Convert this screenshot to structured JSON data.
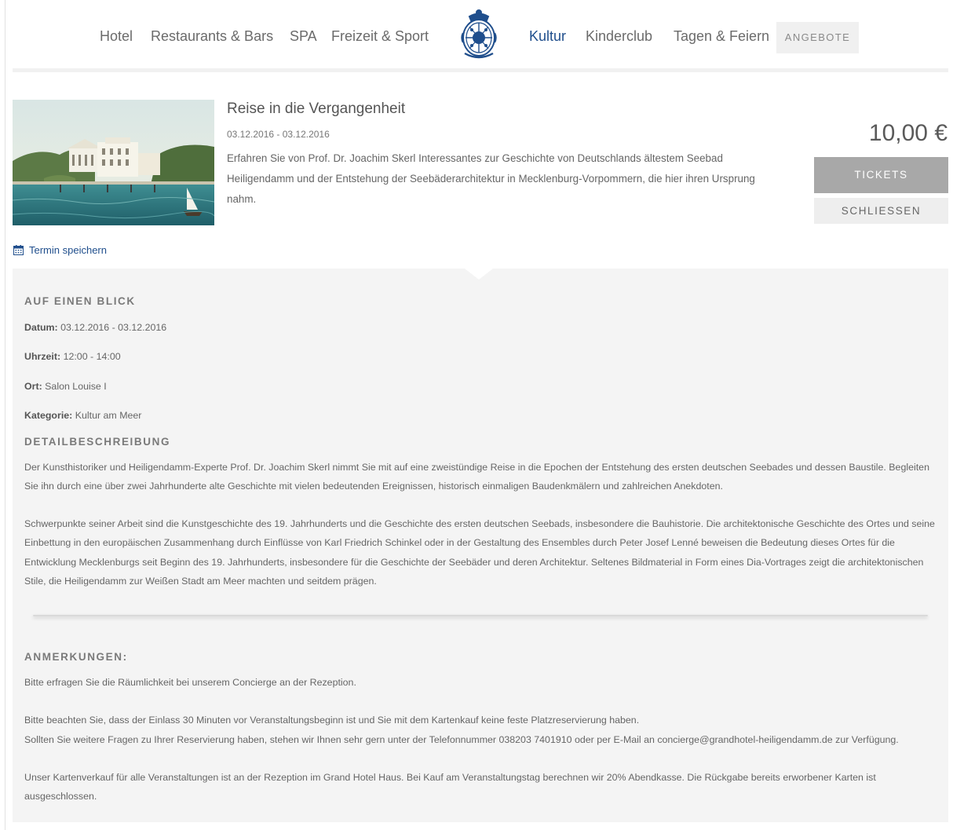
{
  "nav": {
    "items": [
      {
        "label": "Hotel"
      },
      {
        "label": "Restaurants & Bars"
      },
      {
        "label": "SPA"
      },
      {
        "label": "Freizeit & Sport"
      },
      {
        "label": "Kultur",
        "active": true
      },
      {
        "label": "Kinderclub"
      },
      {
        "label": "Tagen & Feiern"
      }
    ],
    "offers_label": "ANGEBOTE",
    "logo_icon": "hotel-crest-icon",
    "active_color": "#1f4e8c"
  },
  "event": {
    "title": "Reise in die Vergangenheit",
    "dates": "03.12.2016 - 03.12.2016",
    "teaser": "Erfahren Sie von Prof. Dr. Joachim Skerl Interessantes zur Geschichte von Deutschlands ältestem Seebad Heiligendamm und der Entstehung der Seebäderarchitektur in Mecklenburg-Vorpommern, die hier ihren Ursprung nahm.",
    "price": "10,00 €",
    "tickets_label": "TICKETS",
    "close_label": "SCHLIESSEN",
    "save_date_label": "Termin speichern",
    "save_date_icon": "calendar-icon"
  },
  "glance": {
    "heading": "AUF EINEN BLICK",
    "date_label": "Datum:",
    "date_value": "03.12.2016 - 03.12.2016",
    "time_label": "Uhrzeit:",
    "time_value": "12:00 - 14:00",
    "place_label": "Ort:",
    "place_value": "Salon Louise I",
    "category_label": "Kategorie:",
    "category_value": "Kultur am Meer"
  },
  "details": {
    "heading": "DETAILBESCHREIBUNG",
    "paragraph_1": "Der Kunsthistoriker und Heiligendamm-Experte Prof. Dr. Joachim Skerl nimmt Sie mit auf eine zweistündige Reise in die Epochen der Entstehung des ersten deutschen Seebades und dessen Baustile. Begleiten Sie ihn durch eine über zwei Jahrhunderte alte Geschichte mit vielen bedeutenden Ereignissen, historisch einmaligen Baudenkmälern und zahlreichen Anekdoten.",
    "paragraph_2": "Schwerpunkte seiner Arbeit sind die Kunstgeschichte des 19. Jahrhunderts und die Geschichte des ersten deutschen Seebads, insbesondere die Bauhistorie. Die architektonische Geschichte des Ortes und seine Einbettung in den europäischen Zusammenhang durch Einflüsse von Karl Friedrich Schinkel oder in der Gestaltung des Ensembles durch Peter Josef Lenné beweisen die Bedeutung dieses Ortes für die Entwicklung Mecklenburgs seit Beginn des 19. Jahrhunderts, insbesondere für die Geschichte der Seebäder und deren Architektur. Seltenes Bildmaterial in Form eines Dia-Vortrages zeigt die architektonischen Stile, die Heiligendamm zur Weißen Stadt am Meer machten und seitdem prägen."
  },
  "notes": {
    "heading": "ANMERKUNGEN:",
    "line_1": "Bitte erfragen Sie die Räumlichkeit bei unserem Concierge an der Rezeption.",
    "line_2": "Bitte beachten Sie, dass der Einlass 30 Minuten vor Veranstaltungsbeginn ist und Sie mit dem Kartenkauf keine feste Platzreservierung haben.",
    "line_3": "Sollten Sie weitere Fragen zu Ihrer Reservierung haben, stehen wir Ihnen sehr gern unter der Telefonnummer 038203 7401910 oder per E-Mail an concierge@grandhotel-heiligendamm.de zur Verfügung.",
    "line_4": "Unser Kartenverkauf für alle Veranstaltungen ist an der Rezeption im Grand Hotel Haus. Bei Kauf am Veranstaltungstag berechnen wir 20% Abendkasse. Die Rückgabe bereits erworbener Karten ist ausgeschlossen."
  }
}
